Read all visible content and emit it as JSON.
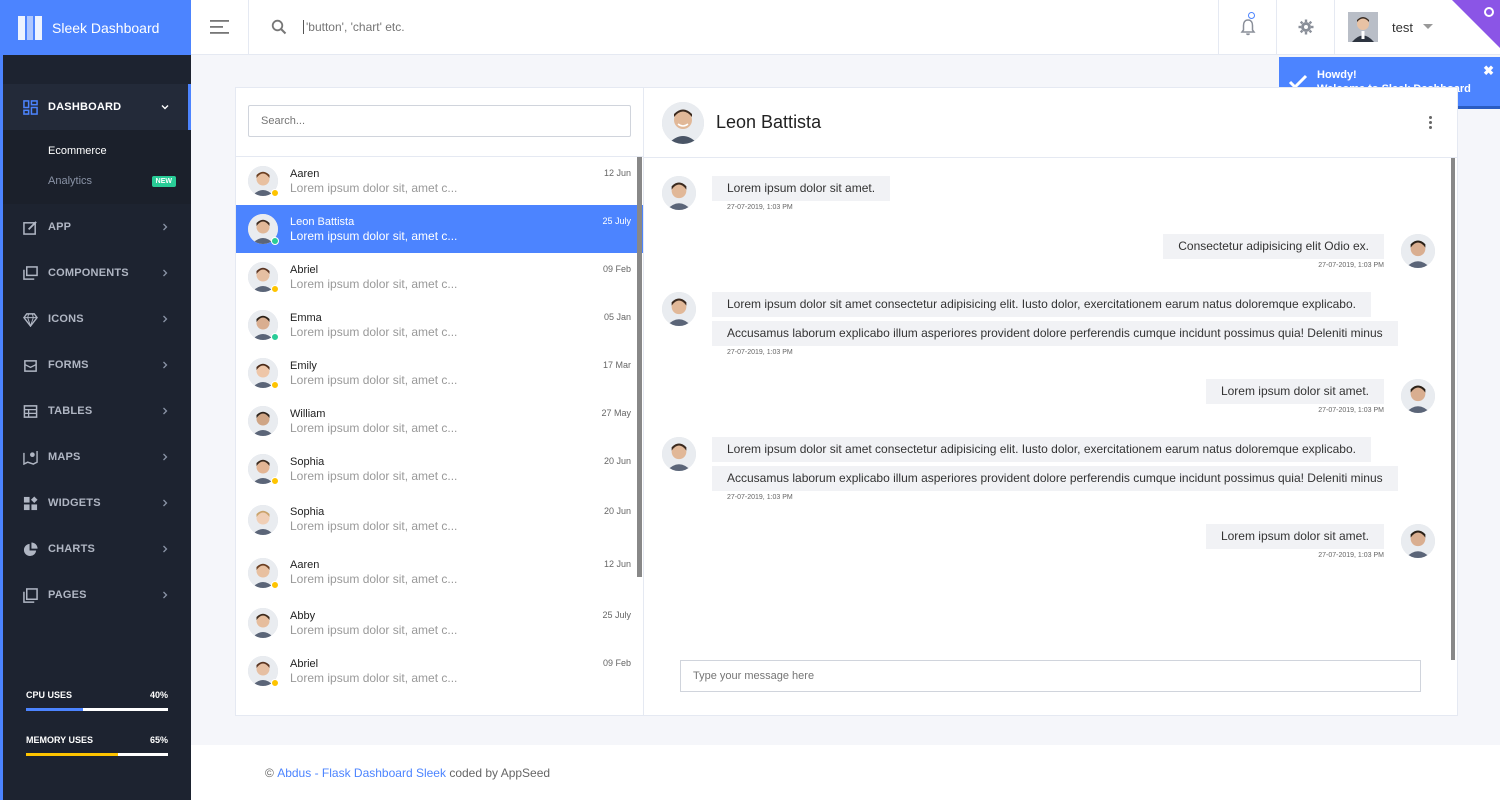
{
  "brand": {
    "title": "Sleek Dashboard"
  },
  "search": {
    "placeholder": "'button', 'chart' etc."
  },
  "header": {
    "username": "test"
  },
  "toast": {
    "title": "Howdy!",
    "message": "Welcome to Sleek Dashboard",
    "close": "✖"
  },
  "sidebar": {
    "dashboard": {
      "label": "Dashboard"
    },
    "submenu": [
      {
        "label": "Ecommerce"
      },
      {
        "label": "Analytics",
        "badge": "NEW"
      }
    ],
    "items": [
      {
        "label": "App",
        "icon": "app-icon"
      },
      {
        "label": "Components",
        "icon": "components-icon"
      },
      {
        "label": "Icons",
        "icon": "diamond-icon"
      },
      {
        "label": "Forms",
        "icon": "forms-icon"
      },
      {
        "label": "Tables",
        "icon": "table-icon"
      },
      {
        "label": "Maps",
        "icon": "map-icon"
      },
      {
        "label": "Widgets",
        "icon": "widgets-icon"
      },
      {
        "label": "Charts",
        "icon": "pie-chart-icon"
      },
      {
        "label": "Pages",
        "icon": "pages-icon"
      }
    ],
    "cpu": {
      "label": "CPU USES",
      "value": "40%",
      "percent": 40,
      "color": "#4c84ff"
    },
    "memory": {
      "label": "MEMORY USES",
      "value": "65%",
      "percent": 65,
      "color": "#fec400"
    }
  },
  "contacts": {
    "search_placeholder": "Search...",
    "list": [
      {
        "name": "Aaren",
        "date": "12 Jun",
        "preview": "Lorem ipsum dolor sit, amet c...",
        "status": "#fec400"
      },
      {
        "name": "Leon Battista",
        "date": "25 July",
        "preview": "Lorem ipsum dolor sit, amet c...",
        "status": "#29cc97"
      },
      {
        "name": "Abriel",
        "date": "09 Feb",
        "preview": "Lorem ipsum dolor sit, amet c...",
        "status": "#fec400"
      },
      {
        "name": "Emma",
        "date": "05 Jan",
        "preview": "Lorem ipsum dolor sit, amet c...",
        "status": "#29cc97"
      },
      {
        "name": "Emily",
        "date": "17 Mar",
        "preview": "Lorem ipsum dolor sit, amet c...",
        "status": "#fec400"
      },
      {
        "name": "William",
        "date": "27 May",
        "preview": "Lorem ipsum dolor sit, amet c...",
        "status": ""
      },
      {
        "name": "Sophia",
        "date": "20 Jun",
        "preview": "Lorem ipsum dolor sit, amet c...",
        "status": "#fec400"
      },
      {
        "name": "Sophia",
        "date": "20 Jun",
        "preview": "Lorem ipsum dolor sit, amet c...",
        "status": ""
      },
      {
        "name": "Aaren",
        "date": "12 Jun",
        "preview": "Lorem ipsum dolor sit, amet c...",
        "status": "#fec400"
      },
      {
        "name": "Abby",
        "date": "25 July",
        "preview": "Lorem ipsum dolor sit, amet c...",
        "status": ""
      },
      {
        "name": "Abriel",
        "date": "09 Feb",
        "preview": "Lorem ipsum dolor sit, amet c...",
        "status": "#fec400"
      }
    ]
  },
  "chat": {
    "title": "Leon Battista",
    "messages": [
      {
        "side": "left",
        "lines": [
          "Lorem ipsum dolor sit amet."
        ],
        "time": "27-07-2019, 1:03 PM"
      },
      {
        "side": "right",
        "lines": [
          "Consectetur adipisicing elit Odio ex."
        ],
        "time": "27-07-2019, 1:03 PM"
      },
      {
        "side": "left",
        "lines": [
          "Lorem ipsum dolor sit amet consectetur adipisicing elit. Iusto dolor, exercitationem earum natus doloremque explicabo.",
          "Accusamus laborum explicabo illum asperiores provident dolore perferendis cumque incidunt possimus quia! Deleniti minus"
        ],
        "time": "27-07-2019, 1:03 PM"
      },
      {
        "side": "right",
        "lines": [
          "Lorem ipsum dolor sit amet."
        ],
        "time": "27-07-2019, 1:03 PM"
      },
      {
        "side": "left",
        "lines": [
          "Lorem ipsum dolor sit amet consectetur adipisicing elit. Iusto dolor, exercitationem earum natus doloremque explicabo.",
          "Accusamus laborum explicabo illum asperiores provident dolore perferendis cumque incidunt possimus quia! Deleniti minus"
        ],
        "time": "27-07-2019, 1:03 PM"
      },
      {
        "side": "right",
        "lines": [
          "Lorem ipsum dolor sit amet."
        ],
        "time": "27-07-2019, 1:03 PM"
      }
    ],
    "compose_placeholder": "Type your message here"
  },
  "footer": {
    "copy": "©",
    "author": "Abdus",
    "sep": "-",
    "product": "Flask Dashboard Sleek",
    "suffix": "coded by AppSeed"
  }
}
